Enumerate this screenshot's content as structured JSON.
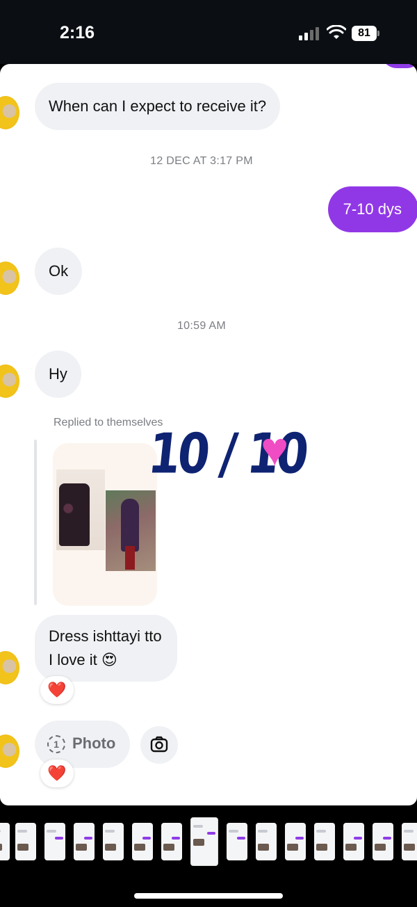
{
  "status_bar": {
    "time": "2:16",
    "battery": "81"
  },
  "messages": {
    "m1": "When can I expect to receive it?",
    "ts1": "12 DEC AT 3:17 PM",
    "m2": "7-10 dys",
    "m3": "Ok",
    "ts2": "10:59 AM",
    "m4": "Hy",
    "replied_label": "Replied to themselves",
    "story_sticker": "10 / 10",
    "m5_line1": "Dress ishttayi tto",
    "m5_line2": "I love it",
    "m5_emoji": "😍",
    "reaction": "❤️",
    "photo_count": "1",
    "photo_label": "Photo"
  },
  "colors": {
    "outgoing_bubble": "#9138e6",
    "incoming_bubble": "#eff1f4",
    "sticker_text": "#0f2373",
    "sticker_heart": "#f04cc3"
  },
  "icons": [
    "signal-icon",
    "wifi-icon",
    "battery-icon",
    "camera-icon",
    "heart-reaction-icon",
    "photo-count-icon"
  ]
}
